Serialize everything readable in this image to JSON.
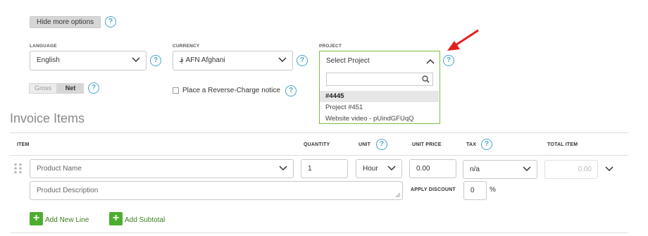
{
  "options_button": "Hide more options",
  "help_glyph": "?",
  "language": {
    "label": "LANGUAGE",
    "value": "English"
  },
  "currency": {
    "label": "CURRENCY",
    "value": "؋ AFN Afghani"
  },
  "project": {
    "label": "PROJECT",
    "value": "Select Project",
    "search_placeholder": "",
    "options": [
      "#4445",
      "Project #451",
      "Website video - pUindGFUqQ"
    ]
  },
  "toggle": {
    "gross": "Gross",
    "net": "Net"
  },
  "reverse_charge": {
    "label": "Place a Reverse-Charge notice"
  },
  "section_title": "Invoice Items",
  "columns": {
    "item": "ITEM",
    "quantity": "QUANTITY",
    "unit": "UNIT",
    "unit_price": "UNIT PRICE",
    "tax": "TAX",
    "total_item": "TOTAL ITEM"
  },
  "row": {
    "product_name_placeholder": "Product Name",
    "product_desc_placeholder": "Product Description",
    "quantity": "1",
    "unit": "Hour",
    "unit_price": "0.00",
    "tax": "n/a",
    "total": "0.00",
    "apply_discount": "APPLY DISCOUNT",
    "discount_value": "0",
    "discount_unit": "%"
  },
  "actions": {
    "add_line": "Add New Line",
    "add_subtotal": "Add Subtotal"
  },
  "colors": {
    "accent_green": "#4cae30",
    "dropdown_border": "#7dbf3a",
    "help_blue": "#4aa6c9",
    "arrow_red": "#e21f1f"
  },
  "icons": {
    "plus": "+",
    "search": "search-icon",
    "chevron": "chevron-down-icon"
  }
}
